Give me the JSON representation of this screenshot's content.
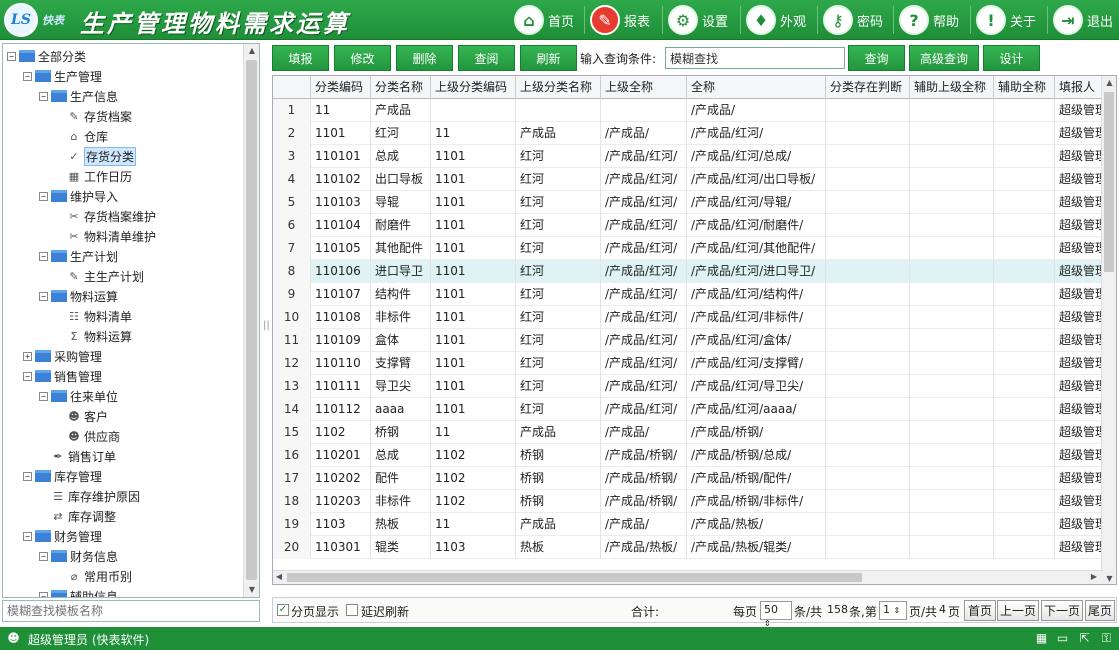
{
  "header": {
    "brand": "快表",
    "title": "生产管理物料需求运算",
    "nav": [
      {
        "label": "首页",
        "icon": "home-icon",
        "glyph": "⌂"
      },
      {
        "label": "报表",
        "icon": "report-icon",
        "glyph": "✎"
      },
      {
        "label": "设置",
        "icon": "settings-icon",
        "glyph": "⚙"
      },
      {
        "label": "外观",
        "icon": "shirt-icon",
        "glyph": "♦"
      },
      {
        "label": "密码",
        "icon": "key-icon",
        "glyph": "⚷"
      },
      {
        "label": "帮助",
        "icon": "help-icon",
        "glyph": "?"
      },
      {
        "label": "关于",
        "icon": "info-icon",
        "glyph": "!"
      },
      {
        "label": "退出",
        "icon": "exit-icon",
        "glyph": "⇥"
      }
    ]
  },
  "tree": [
    {
      "label": "全部分类",
      "level": 0,
      "type": "folder",
      "toggle": "−"
    },
    {
      "label": "生产管理",
      "level": 1,
      "type": "folder",
      "toggle": "−"
    },
    {
      "label": "生产信息",
      "level": 2,
      "type": "folder",
      "toggle": "−"
    },
    {
      "label": "存货档案",
      "level": 3,
      "type": "leaf",
      "glyph": "✎"
    },
    {
      "label": "仓库",
      "level": 3,
      "type": "leaf",
      "glyph": "⌂"
    },
    {
      "label": "存货分类",
      "level": 3,
      "type": "leaf",
      "glyph": "✓",
      "selected": true
    },
    {
      "label": "工作日历",
      "level": 3,
      "type": "leaf",
      "glyph": "▦"
    },
    {
      "label": "维护导入",
      "level": 2,
      "type": "folder",
      "toggle": "−"
    },
    {
      "label": "存货档案维护",
      "level": 3,
      "type": "leaf",
      "glyph": "✂"
    },
    {
      "label": "物料清单维护",
      "level": 3,
      "type": "leaf",
      "glyph": "✂"
    },
    {
      "label": "生产计划",
      "level": 2,
      "type": "folder",
      "toggle": "−"
    },
    {
      "label": "主生产计划",
      "level": 3,
      "type": "leaf",
      "glyph": "✎"
    },
    {
      "label": "物料运算",
      "level": 2,
      "type": "folder",
      "toggle": "−"
    },
    {
      "label": "物料清单",
      "level": 3,
      "type": "leaf",
      "glyph": "☷"
    },
    {
      "label": "物料运算",
      "level": 3,
      "type": "leaf",
      "glyph": "Σ"
    },
    {
      "label": "采购管理",
      "level": 1,
      "type": "folder",
      "toggle": "+"
    },
    {
      "label": "销售管理",
      "level": 1,
      "type": "folder",
      "toggle": "−"
    },
    {
      "label": "往来单位",
      "level": 2,
      "type": "folder",
      "toggle": "−"
    },
    {
      "label": "客户",
      "level": 3,
      "type": "leaf",
      "glyph": "☻"
    },
    {
      "label": "供应商",
      "level": 3,
      "type": "leaf",
      "glyph": "☻"
    },
    {
      "label": "销售订单",
      "level": 2,
      "type": "leaf",
      "glyph": "✒"
    },
    {
      "label": "库存管理",
      "level": 1,
      "type": "folder",
      "toggle": "−"
    },
    {
      "label": "库存维护原因",
      "level": 2,
      "type": "leaf",
      "glyph": "☰"
    },
    {
      "label": "库存调整",
      "level": 2,
      "type": "leaf",
      "glyph": "⇄"
    },
    {
      "label": "财务管理",
      "level": 1,
      "type": "folder",
      "toggle": "−"
    },
    {
      "label": "财务信息",
      "level": 2,
      "type": "folder",
      "toggle": "−"
    },
    {
      "label": "常用币别",
      "level": 3,
      "type": "leaf",
      "glyph": "⌀"
    },
    {
      "label": "辅助信息",
      "level": 2,
      "type": "folder",
      "toggle": "−"
    }
  ],
  "left_search": {
    "placeholder": "模糊查找模板名称"
  },
  "toolbar": {
    "buttons": [
      "填报",
      "修改",
      "删除",
      "查阅",
      "刷新"
    ],
    "query_label": "输入查询条件:",
    "query_value": "模糊查找",
    "buttons2": [
      "查询",
      "高级查询",
      "设计"
    ]
  },
  "table": {
    "columns": [
      "",
      "分类编码",
      "分类名称",
      "上级分类编码",
      "上级分类名称",
      "上级全称",
      "全称",
      "分类存在判断",
      "辅助上级全称",
      "辅助全称",
      "填报人"
    ],
    "rows": [
      [
        "1",
        "11",
        "产成品",
        "",
        "",
        "",
        "/产成品/",
        "",
        "",
        "",
        "超级管理"
      ],
      [
        "2",
        "1101",
        "红河",
        "11",
        "产成品",
        "/产成品/",
        "/产成品/红河/",
        "",
        "",
        "",
        "超级管理"
      ],
      [
        "3",
        "110101",
        "总成",
        "1101",
        "红河",
        "/产成品/红河/",
        "/产成品/红河/总成/",
        "",
        "",
        "",
        "超级管理"
      ],
      [
        "4",
        "110102",
        "出口导板",
        "1101",
        "红河",
        "/产成品/红河/",
        "/产成品/红河/出口导板/",
        "",
        "",
        "",
        "超级管理"
      ],
      [
        "5",
        "110103",
        "导辊",
        "1101",
        "红河",
        "/产成品/红河/",
        "/产成品/红河/导辊/",
        "",
        "",
        "",
        "超级管理"
      ],
      [
        "6",
        "110104",
        "耐磨件",
        "1101",
        "红河",
        "/产成品/红河/",
        "/产成品/红河/耐磨件/",
        "",
        "",
        "",
        "超级管理"
      ],
      [
        "7",
        "110105",
        "其他配件",
        "1101",
        "红河",
        "/产成品/红河/",
        "/产成品/红河/其他配件/",
        "",
        "",
        "",
        "超级管理"
      ],
      [
        "8",
        "110106",
        "进口导卫",
        "1101",
        "红河",
        "/产成品/红河/",
        "/产成品/红河/进口导卫/",
        "",
        "",
        "",
        "超级管理"
      ],
      [
        "9",
        "110107",
        "结构件",
        "1101",
        "红河",
        "/产成品/红河/",
        "/产成品/红河/结构件/",
        "",
        "",
        "",
        "超级管理"
      ],
      [
        "10",
        "110108",
        "非标件",
        "1101",
        "红河",
        "/产成品/红河/",
        "/产成品/红河/非标件/",
        "",
        "",
        "",
        "超级管理"
      ],
      [
        "11",
        "110109",
        "盒体",
        "1101",
        "红河",
        "/产成品/红河/",
        "/产成品/红河/盒体/",
        "",
        "",
        "",
        "超级管理"
      ],
      [
        "12",
        "110110",
        "支撑臂",
        "1101",
        "红河",
        "/产成品/红河/",
        "/产成品/红河/支撑臂/",
        "",
        "",
        "",
        "超级管理"
      ],
      [
        "13",
        "110111",
        "导卫尖",
        "1101",
        "红河",
        "/产成品/红河/",
        "/产成品/红河/导卫尖/",
        "",
        "",
        "",
        "超级管理"
      ],
      [
        "14",
        "110112",
        "aaaa",
        "1101",
        "红河",
        "/产成品/红河/",
        "/产成品/红河/aaaa/",
        "",
        "",
        "",
        "超级管理"
      ],
      [
        "15",
        "1102",
        "桥钢",
        "11",
        "产成品",
        "/产成品/",
        "/产成品/桥钢/",
        "",
        "",
        "",
        "超级管理"
      ],
      [
        "16",
        "110201",
        "总成",
        "1102",
        "桥钢",
        "/产成品/桥钢/",
        "/产成品/桥钢/总成/",
        "",
        "",
        "",
        "超级管理"
      ],
      [
        "17",
        "110202",
        "配件",
        "1102",
        "桥钢",
        "/产成品/桥钢/",
        "/产成品/桥钢/配件/",
        "",
        "",
        "",
        "超级管理"
      ],
      [
        "18",
        "110203",
        "非标件",
        "1102",
        "桥钢",
        "/产成品/桥钢/",
        "/产成品/桥钢/非标件/",
        "",
        "",
        "",
        "超级管理"
      ],
      [
        "19",
        "1103",
        "热板",
        "11",
        "产成品",
        "/产成品/",
        "/产成品/热板/",
        "",
        "",
        "",
        "超级管理"
      ],
      [
        "20",
        "110301",
        "辊类",
        "1103",
        "热板",
        "/产成品/热板/",
        "/产成品/热板/辊类/",
        "",
        "",
        "",
        "超级管理"
      ]
    ],
    "highlight_row": 8
  },
  "pager": {
    "page_show": "分页显示",
    "delay_refresh": "延迟刷新",
    "total_label": "合计:",
    "per_page_pre": "每页",
    "per_page_value": "50",
    "per_page_post": "条/共",
    "total_count": "158",
    "count_post": "条,第",
    "page_value": "1",
    "page_mid": "页/共",
    "page_count": "4",
    "page_post": "页",
    "buttons": [
      "首页",
      "上一页",
      "下一页",
      "尾页"
    ]
  },
  "status": {
    "user": "超级管理员 (快表软件)"
  },
  "colors": {
    "brand_green": "#1f8f38",
    "highlight_row": "#dff2f4",
    "folder_blue": "#3b82d6"
  }
}
